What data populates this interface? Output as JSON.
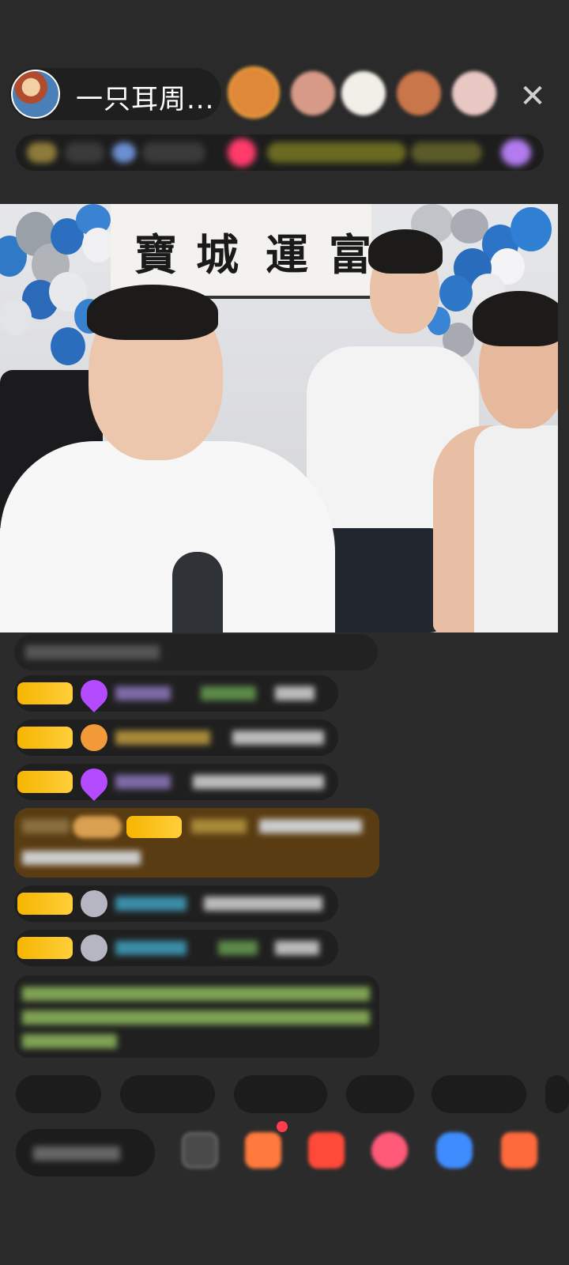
{
  "header": {
    "host_name": "一只耳周...",
    "close_icon": "close-icon",
    "viewer_avatar_colors": [
      "#e0883a",
      "#d79a87",
      "#f1efe8",
      "#c9764a",
      "#e9c8c4"
    ]
  },
  "rank_strip": {
    "items": [
      "",
      "",
      "",
      ""
    ]
  },
  "video": {
    "calligraphy_chars": [
      "寶",
      "城",
      "運",
      "富"
    ]
  },
  "chat": {
    "messages": [
      {
        "type": "system",
        "text": ""
      },
      {
        "type": "gift",
        "badge_color": "#f6b500",
        "icon": "diamond-heart-icon",
        "icon_color": "#b44bff"
      },
      {
        "type": "gift",
        "badge_color": "#f6b500",
        "icon": "balloon-heart-icon",
        "icon_color": "#f29a3a"
      },
      {
        "type": "gift",
        "badge_color": "#f6b500",
        "icon": "diamond-heart-icon",
        "icon_color": "#b44bff"
      },
      {
        "type": "highlight",
        "bg_color": "#5a3c12"
      },
      {
        "type": "gift",
        "badge_color": "#f6b500",
        "icon": "gray-heart-icon",
        "icon_color": "#b6b6c2"
      },
      {
        "type": "gift",
        "badge_color": "#f6b500",
        "icon": "gray-heart-icon",
        "icon_color": "#b6b6c2"
      },
      {
        "type": "notice",
        "text_color": "#9ed36a"
      }
    ]
  },
  "quick_replies": {
    "items": [
      "",
      "",
      "",
      "",
      ""
    ]
  },
  "bottom": {
    "input_placeholder": "",
    "icons": [
      "emoji-icon",
      "gift-box-icon",
      "red-packet-icon",
      "heart-icon",
      "game-controller-icon",
      "more-apps-icon"
    ],
    "icon_colors": [
      "#606060",
      "#ff7a3c",
      "#ff4a3a",
      "#ff5a78",
      "#3f8cff",
      "#ff6a3c"
    ]
  }
}
